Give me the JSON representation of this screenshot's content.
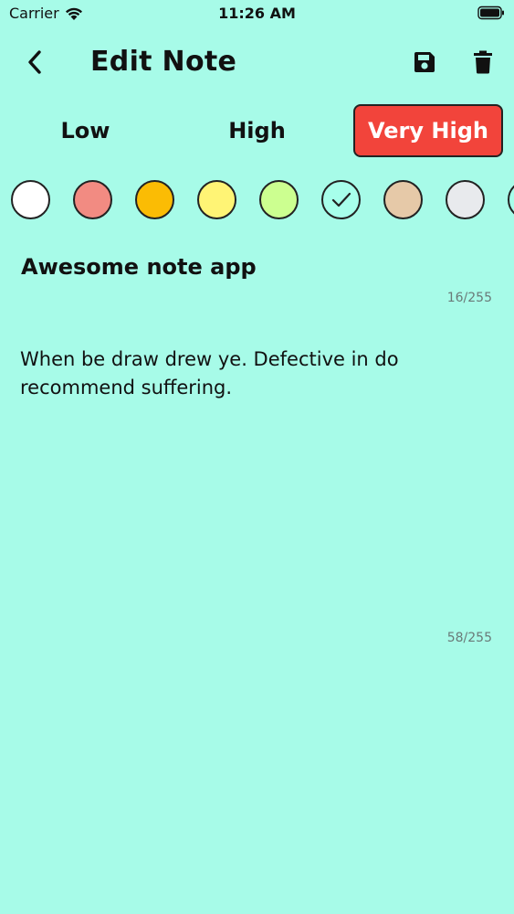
{
  "status_bar": {
    "carrier": "Carrier",
    "time": "11:26 AM"
  },
  "header": {
    "title": "Edit Note",
    "back_icon": "chevron-left-icon",
    "save_icon": "floppy-disk-icon",
    "delete_icon": "trash-icon"
  },
  "priority": {
    "options": [
      "Low",
      "High",
      "Very High"
    ],
    "selected": "Very High",
    "selected_color": "#f2443b"
  },
  "colors": {
    "swatches": [
      "#ffffff",
      "#f28b82",
      "#fbbc04",
      "#fff475",
      "#ccff90",
      "#a7ffeb",
      "#e6c9a8",
      "#e8eaed",
      "#a7ffeb"
    ],
    "selected_index": 5
  },
  "note": {
    "title": "Awesome note app",
    "title_counter": "16/255",
    "body": "When be draw drew ye. Defective in do recommend suffering.",
    "body_counter": "58/255"
  },
  "theme": {
    "background": "#a7fbe8"
  }
}
